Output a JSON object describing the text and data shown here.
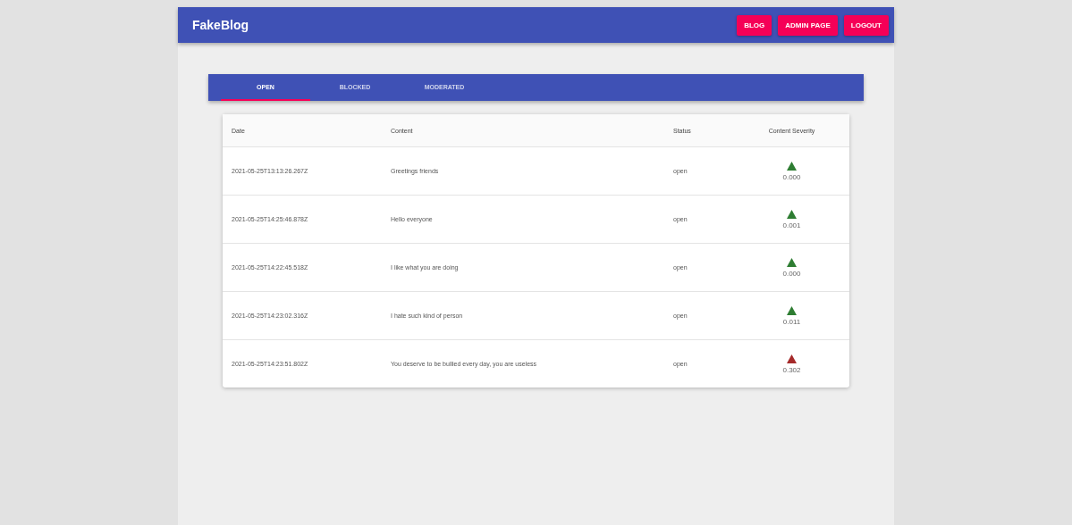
{
  "app_bar": {
    "title": "FakeBlog",
    "buttons": [
      "BLOG",
      "ADMIN PAGE",
      "LOGOUT"
    ]
  },
  "tabs": [
    {
      "label": "OPEN",
      "selected": true
    },
    {
      "label": "BLOCKED",
      "selected": false
    },
    {
      "label": "MODERATED",
      "selected": false
    }
  ],
  "table": {
    "columns": [
      "Date",
      "Content",
      "Status",
      "Content Severity"
    ],
    "rows": [
      {
        "date": "2021-05-25T13:13:26.267Z",
        "content": "Greetings friends",
        "status": "open",
        "severity": "0.000",
        "color": "#2e7d32"
      },
      {
        "date": "2021-05-25T14:25:46.878Z",
        "content": "Hello everyone",
        "status": "open",
        "severity": "0.001",
        "color": "#2e7d32"
      },
      {
        "date": "2021-05-25T14:22:45.518Z",
        "content": "I like what you are doing",
        "status": "open",
        "severity": "0.000",
        "color": "#2e7d32"
      },
      {
        "date": "2021-05-25T14:23:02.316Z",
        "content": "I hate such kind of person",
        "status": "open",
        "severity": "0.011",
        "color": "#2e7d32"
      },
      {
        "date": "2021-05-25T14:23:51.802Z",
        "content": "You deserve to be bullied every day, you are useless",
        "status": "open",
        "severity": "0.302",
        "color": "#a52a2a"
      }
    ]
  }
}
